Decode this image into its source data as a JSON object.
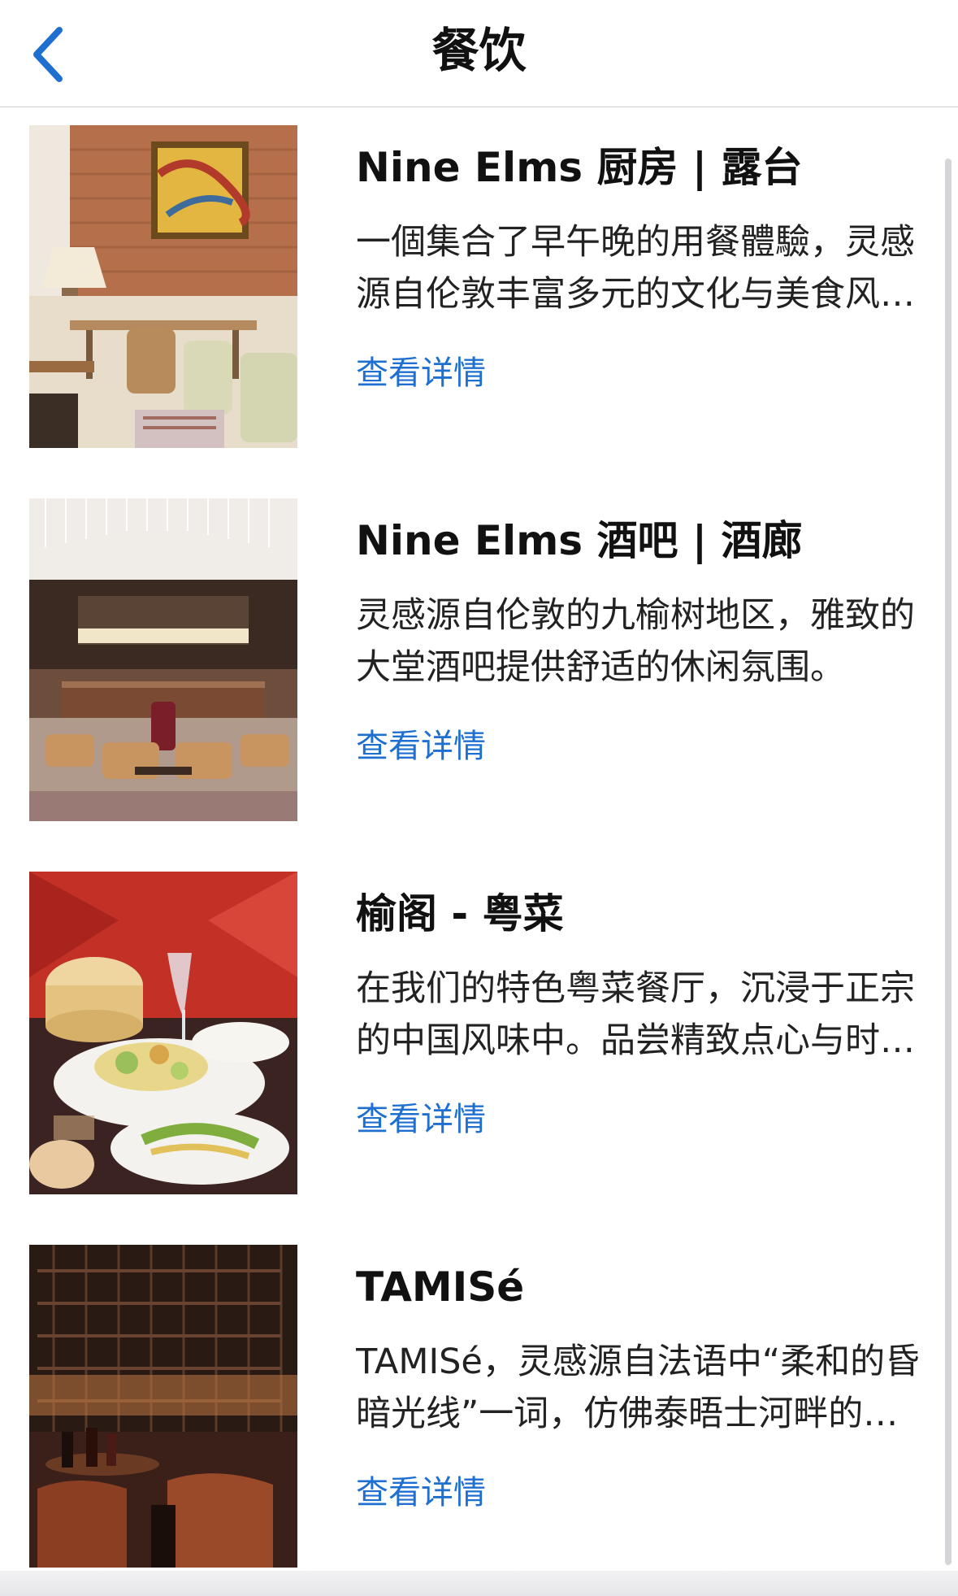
{
  "nav": {
    "title": "餐饮",
    "back_icon": "chevron-left-icon",
    "accent_color": "#1e6fd0"
  },
  "items": [
    {
      "title": "Nine Elms 厨房 | 露台",
      "description": "一個集合了早午晚的用餐體驗，灵感源自伦敦丰富多元的文化与美食风味。",
      "link": "查看详情"
    },
    {
      "title": "Nine Elms 酒吧 | 酒廊",
      "description": "灵感源自伦敦的九榆树地区，雅致的大堂酒吧提供舒适的休闲氛围。",
      "link": "查看详情"
    },
    {
      "title": "榆阁 - 粤菜",
      "description": "在我们的特色粤菜餐厅，沉浸于正宗的中国风味中。品尝精致点心与时令佳肴。",
      "link": "查看详情"
    },
    {
      "title": "TAMISé",
      "description": "TAMISé，灵感源自法语中“柔和的昏暗光线”一词，仿佛泰晤士河畔的夕阳余晖。",
      "link": "查看详情"
    }
  ]
}
